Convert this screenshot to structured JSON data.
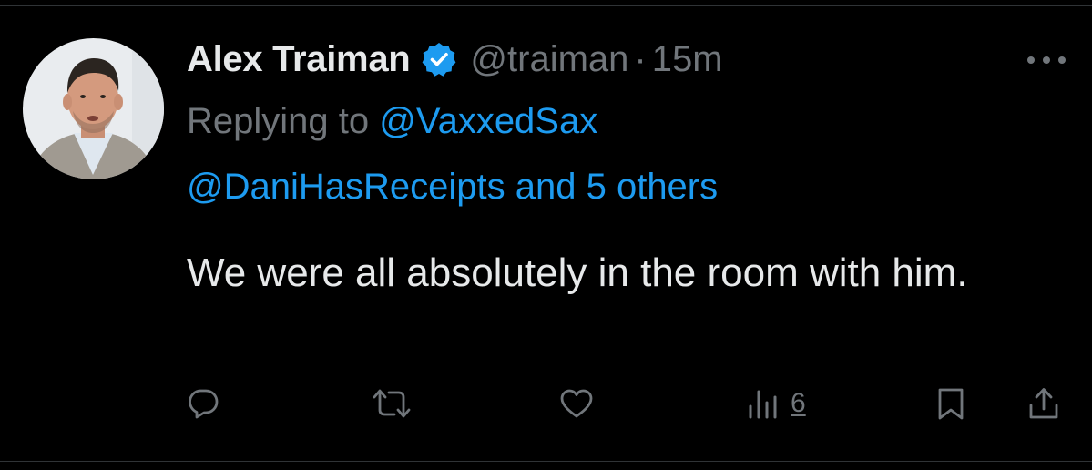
{
  "tweet": {
    "author": {
      "display_name": "Alex Traiman",
      "handle": "@traiman",
      "verified": true,
      "avatar": "profile-photo"
    },
    "separator": "·",
    "timestamp": "15m",
    "replying_to": {
      "prefix": "Replying to",
      "primary": "@VaxxedSax",
      "secondary": "@DaniHasReceipts and 5 others"
    },
    "text": "We were all absolutely in the room with him.",
    "actions": {
      "reply_icon": "reply-icon",
      "retweet_icon": "retweet-icon",
      "like_icon": "heart-icon",
      "views_icon": "views-icon",
      "views_count": "6",
      "bookmark_icon": "bookmark-icon",
      "share_icon": "share-icon"
    },
    "menu_icon": "more-icon"
  },
  "colors": {
    "background": "#000000",
    "primary_text": "#e7e9ea",
    "secondary_text": "#71767b",
    "link": "#1d9bf0",
    "verified_badge": "#1d9bf0"
  }
}
